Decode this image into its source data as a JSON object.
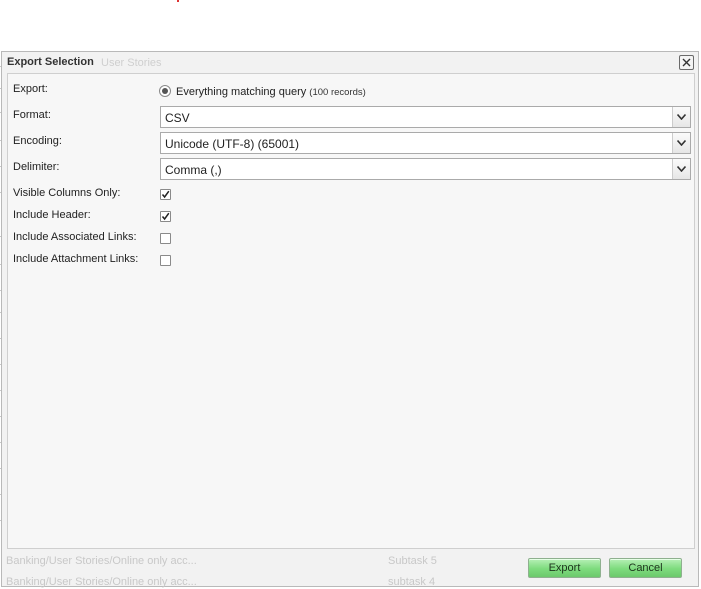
{
  "dialog": {
    "title": "Export Selection",
    "title_ghost": "User Stories",
    "close_icon": "close-icon"
  },
  "form": {
    "export_label": "Export:",
    "export_option": "Everything matching query",
    "export_count": "(100 records)",
    "format_label": "Format:",
    "format_value": "CSV",
    "encoding_label": "Encoding:",
    "encoding_value": "Unicode (UTF-8) (65001)",
    "delimiter_label": "Delimiter:",
    "delimiter_value": "Comma (,)",
    "visible_columns_label": "Visible Columns Only:",
    "visible_columns_checked": true,
    "include_header_label": "Include Header:",
    "include_header_checked": true,
    "associated_links_label": "Include Associated Links:",
    "associated_links_checked": false,
    "attachment_links_label": "Include Attachment Links:",
    "attachment_links_checked": false
  },
  "buttons": {
    "export": "Export",
    "cancel": "Cancel"
  },
  "background": {
    "row1_path": "Banking/User Stories/Online only acc...",
    "row1_type": "Subtask 5",
    "row2_path": "Banking/User Stories/Online only acc...",
    "row2_type": "subtask 4"
  },
  "colors": {
    "button_green": "#7ddb7d",
    "dialog_bg": "#f2f2f2"
  }
}
